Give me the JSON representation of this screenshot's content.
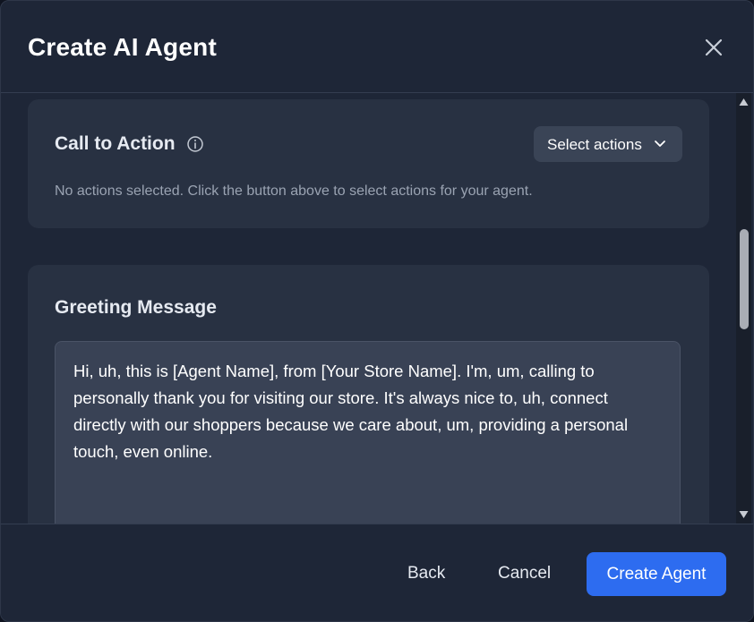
{
  "dialog": {
    "title": "Create AI Agent"
  },
  "call_to_action": {
    "title": "Call to Action",
    "select_label": "Select actions",
    "empty_text": "No actions selected. Click the button above to select actions for your agent."
  },
  "greeting": {
    "title": "Greeting Message",
    "value": "Hi, uh, this is [Agent Name], from [Your Store Name]. I'm, um, calling to personally thank you for visiting our store. It's always nice to, uh, connect directly with our shoppers because we care about, um, providing a personal touch, even online."
  },
  "footer": {
    "back_label": "Back",
    "cancel_label": "Cancel",
    "create_label": "Create Agent"
  },
  "colors": {
    "accent": "#2d6cf0",
    "background": "#1e2637",
    "card": "#283142"
  },
  "icons": [
    "close-icon",
    "info-icon",
    "chevron-down-icon",
    "scroll-up-arrow-icon",
    "scroll-down-arrow-icon"
  ]
}
